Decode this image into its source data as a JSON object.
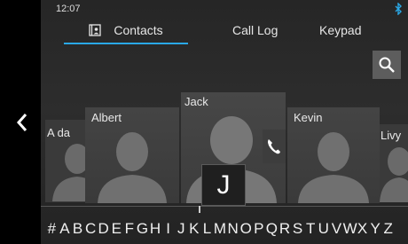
{
  "status_bar": {
    "time": "12:07",
    "bluetooth_icon": "bluetooth-icon"
  },
  "tabs": [
    {
      "label": "Contacts",
      "icon": "contacts-book-icon",
      "active": true
    },
    {
      "label": "Call Log",
      "active": false
    },
    {
      "label": "Keypad",
      "active": false
    }
  ],
  "icons": {
    "back": "chevron-left-icon",
    "search": "search-icon",
    "call": "phone-handset-icon",
    "avatar": "person-silhouette-icon"
  },
  "contacts": [
    {
      "name": "A da"
    },
    {
      "name": "Albert"
    },
    {
      "name": "Jack"
    },
    {
      "name": "Kevin"
    },
    {
      "name": "Livy"
    }
  ],
  "selected_letter": "J",
  "alphabet": [
    "#",
    "A",
    "B",
    "C",
    "D",
    "E",
    "F",
    "G",
    "H",
    "I",
    "J",
    "K",
    "L",
    "M",
    "N",
    "O",
    "P",
    "Q",
    "R",
    "S",
    "T",
    "U",
    "V",
    "W",
    "X",
    "Y",
    "Z"
  ],
  "colors": {
    "accent": "#2aa8e6",
    "background": "#2b2b2b",
    "sidebar": "#000000",
    "search_button": "#5d5d5d"
  }
}
